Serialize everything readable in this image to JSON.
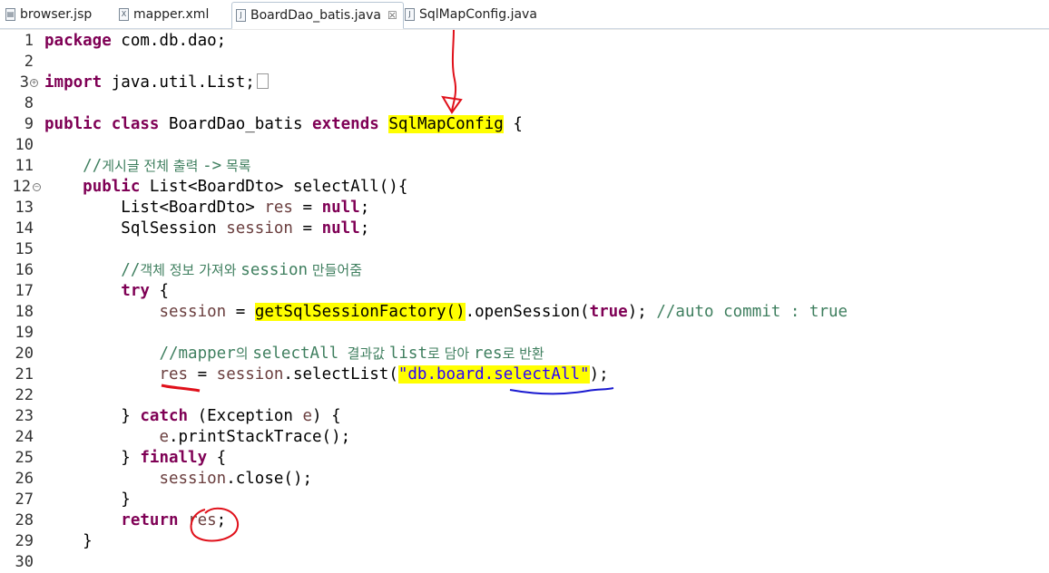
{
  "tabs": [
    {
      "label": "browser.jsp",
      "icon": "jsp-file-icon",
      "active": false
    },
    {
      "label": "mapper.xml",
      "icon": "xml-file-icon",
      "active": false
    },
    {
      "label": "BoardDao_batis.java",
      "icon": "java-file-icon",
      "active": true,
      "close": "☒"
    },
    {
      "label": "SqlMapConfig.java",
      "icon": "java-file-icon",
      "active": false
    }
  ],
  "lines": {
    "l1": {
      "num": "1",
      "kw": "package",
      "rest": " com.db.dao;"
    },
    "l2": {
      "num": "2"
    },
    "l3": {
      "num": "3",
      "kw": "import",
      "rest": " java.util.List;"
    },
    "l8": {
      "num": "8"
    },
    "l9": {
      "num": "9",
      "kw1": "public",
      "kw2": "class",
      "name": " BoardDao_batis ",
      "kw3": "extends",
      "parent": "SqlMapConfig",
      "rest": " {"
    },
    "l10": {
      "num": "10"
    },
    "l11": {
      "num": "11",
      "comment_a": "//",
      "comment_ko": "게시글 전체 출력 ",
      "comment_b": "->",
      "comment_ko2": " 목록"
    },
    "l12": {
      "num": "12",
      "kw": "public",
      "rest": " List<BoardDto> selectAll(){"
    },
    "l13": {
      "num": "13",
      "type": "List<BoardDto> ",
      "var": "res",
      "mid": " = ",
      "kw": "null",
      "end": ";"
    },
    "l14": {
      "num": "14",
      "type": "SqlSession ",
      "var": "session",
      "mid": " = ",
      "kw": "null",
      "end": ";"
    },
    "l15": {
      "num": "15"
    },
    "l16": {
      "num": "16",
      "comment_a": "//",
      "comment_ko": "객체 정보 가져와 ",
      "comment_b": "session",
      "comment_ko2": " 만들어줌"
    },
    "l17": {
      "num": "17",
      "kw": "try",
      "rest": " {"
    },
    "l18": {
      "num": "18",
      "var": "session",
      "mid": " = ",
      "call": "getSqlSessionFactory()",
      "after": ".openSession(",
      "kw": "true",
      "end": "); ",
      "comment": "//auto commit : true"
    },
    "l19": {
      "num": "19"
    },
    "l20": {
      "num": "20",
      "c1": "//mapper",
      "ko1": "의 ",
      "c2": "selectAll",
      "ko2": "  결과값 ",
      "c3": "list",
      "ko3": "로 담아 ",
      "c4": "res",
      "ko4": "로 반환"
    },
    "l21": {
      "num": "21",
      "var": "res",
      "mid": " = ",
      "var2": "session",
      "call": ".selectList(",
      "str": "\"db.board.selectAll\"",
      "end": ");"
    },
    "l22": {
      "num": "22"
    },
    "l23": {
      "num": "23",
      "pre": "} ",
      "kw": "catch",
      "mid": " (Exception ",
      "var": "e",
      "end": ") {"
    },
    "l24": {
      "num": "24",
      "var": "e",
      "rest": ".printStackTrace();"
    },
    "l25": {
      "num": "25",
      "pre": "} ",
      "kw": "finally",
      "rest": " {"
    },
    "l26": {
      "num": "26",
      "var": "session",
      "rest": ".close();"
    },
    "l27": {
      "num": "27",
      "text": "}"
    },
    "l28": {
      "num": "28",
      "kw": "return",
      "sp": " ",
      "var": "res",
      "end": ";"
    },
    "l29": {
      "num": "29",
      "text": "}"
    },
    "l30": {
      "num": "30"
    }
  },
  "colors": {
    "keyword": "#7f0055",
    "comment": "#3f7f5f",
    "field": "#6a3e3e",
    "string": "#2a00ff",
    "highlight": "#ffff00",
    "annotation_red": "#e0101a",
    "annotation_blue": "#1a1ad0"
  }
}
